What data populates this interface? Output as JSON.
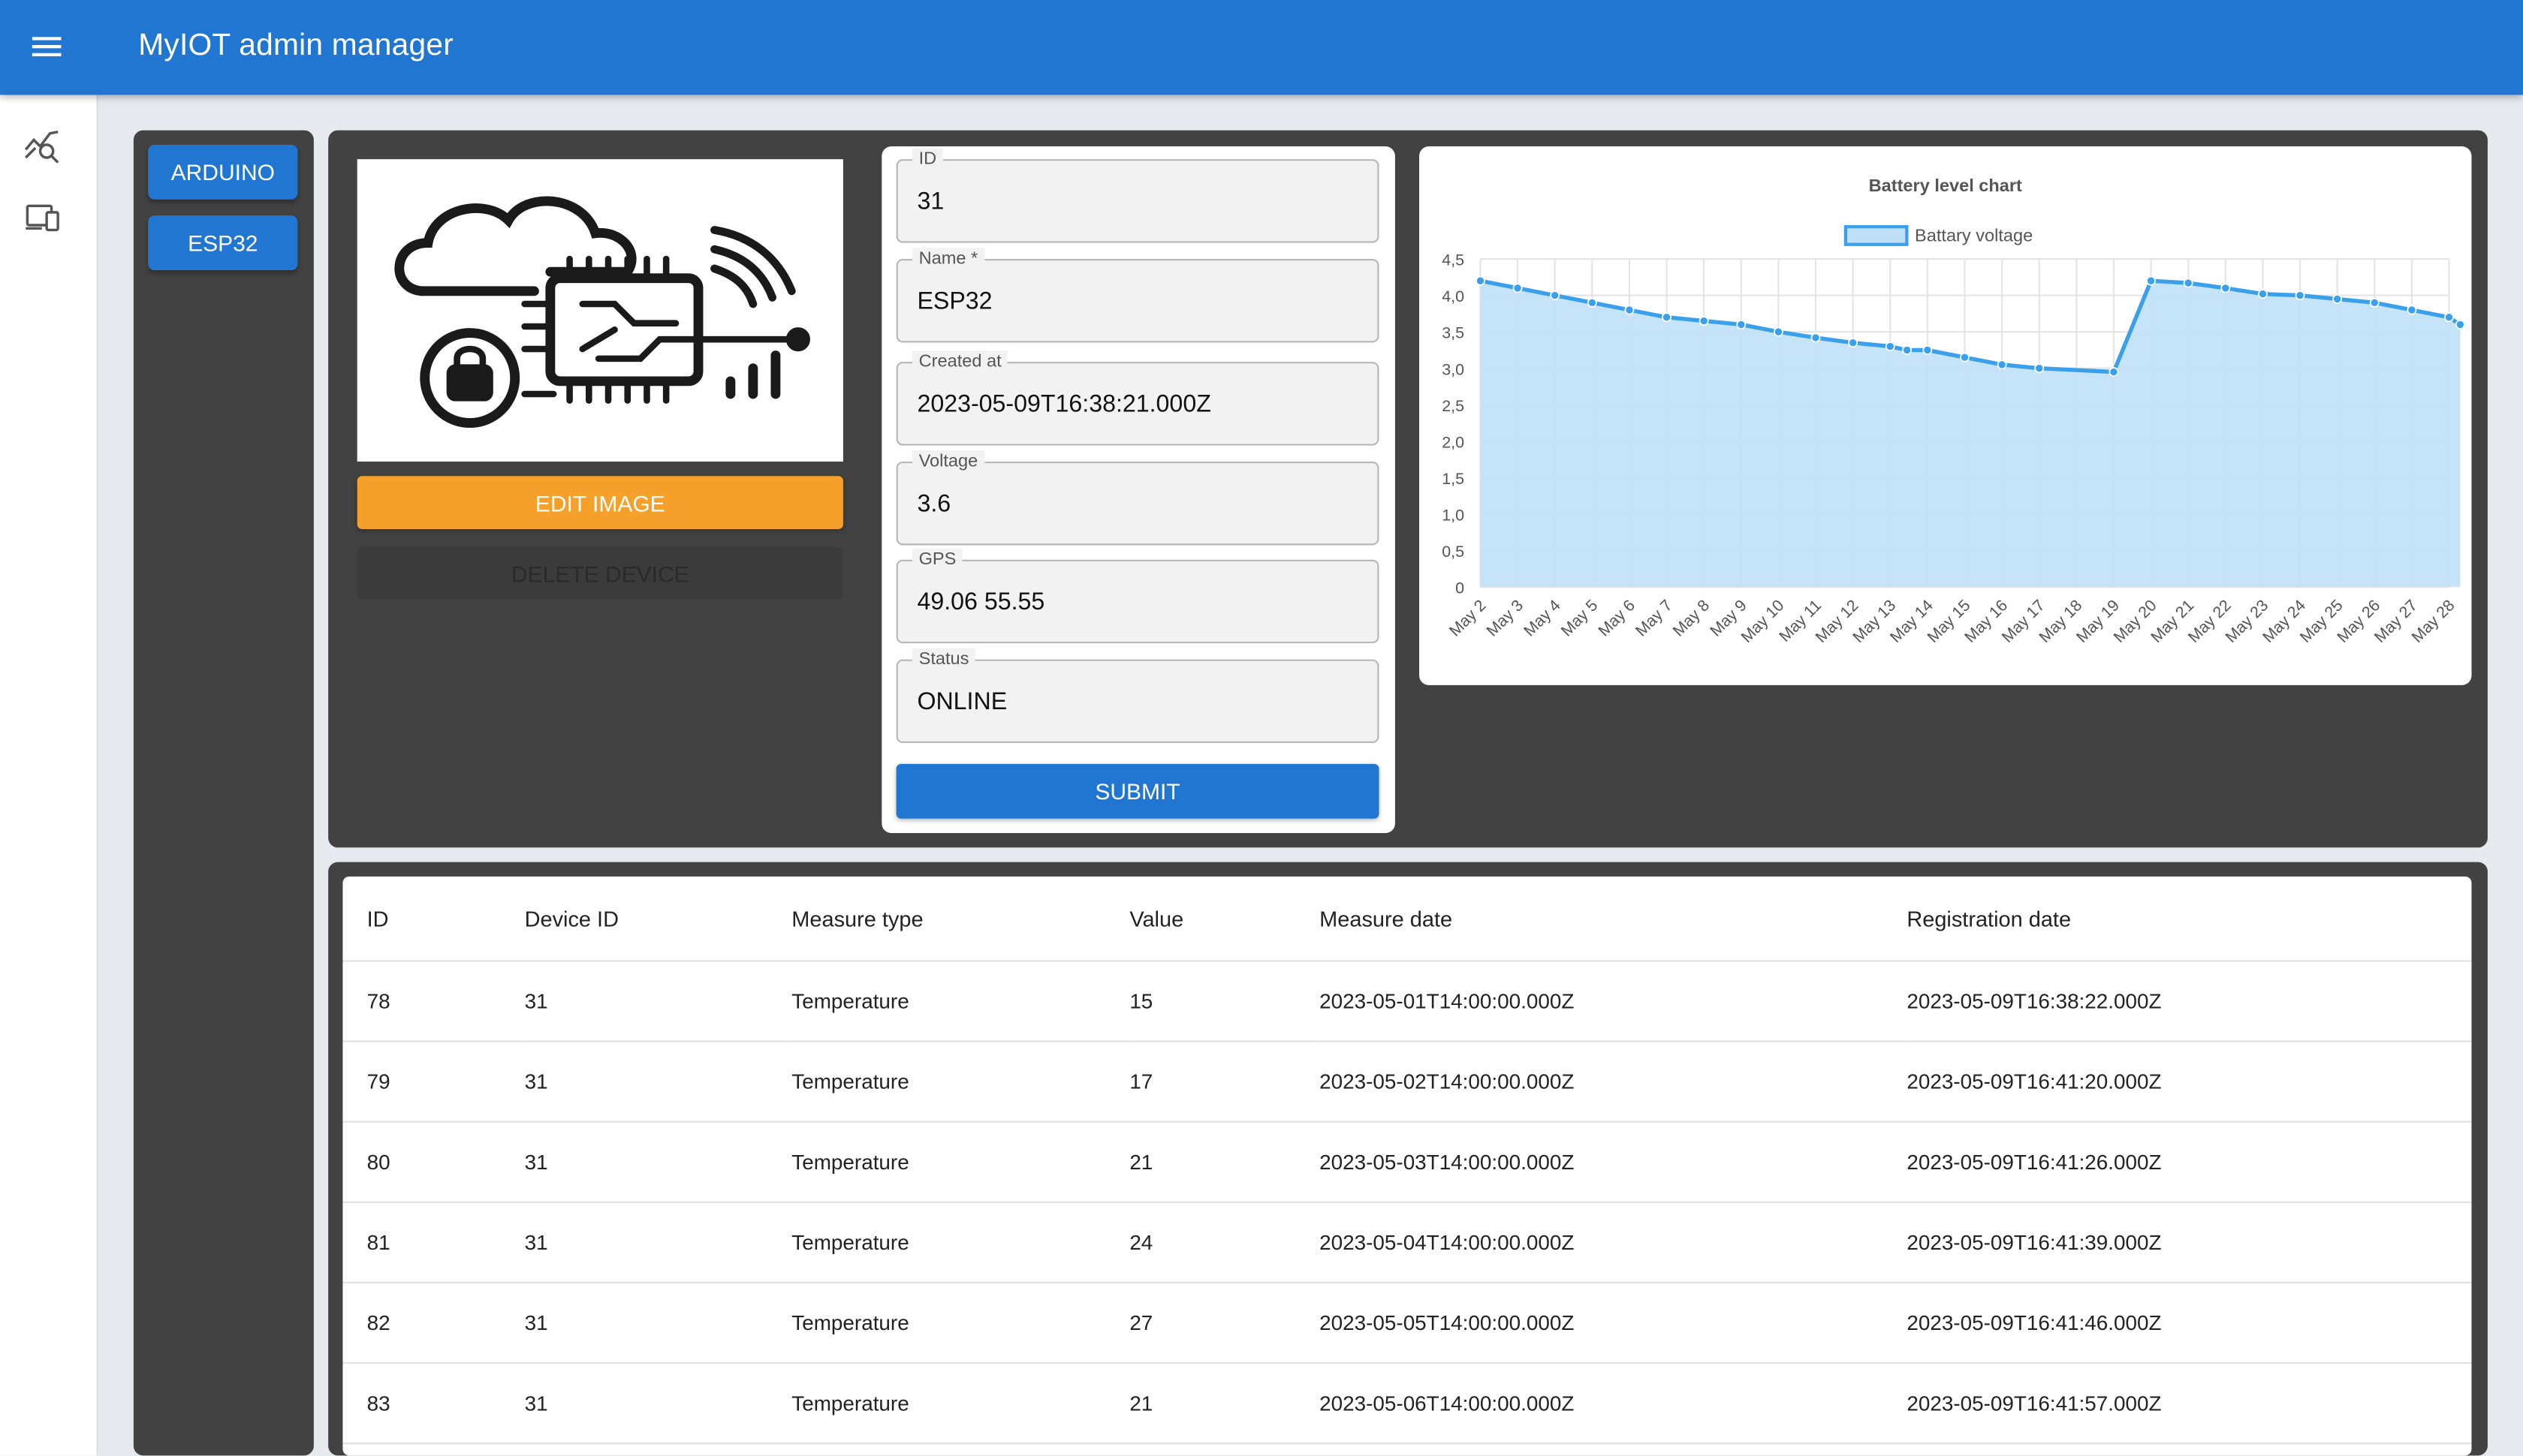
{
  "app": {
    "title": "MyIOT admin manager"
  },
  "nav": {
    "menu_icon": "hamburger-menu-icon",
    "items": [
      {
        "icon": "analytics-search-icon"
      },
      {
        "icon": "devices-icon"
      }
    ]
  },
  "devices": {
    "items": [
      {
        "label": "ARDUINO"
      },
      {
        "label": "ESP32"
      }
    ]
  },
  "device_actions": {
    "edit_label": "EDIT IMAGE",
    "delete_label": "DELETE DEVICE",
    "image": "iot-cloud-chip-illustration"
  },
  "form": {
    "fields": [
      {
        "label": "ID",
        "value": "31"
      },
      {
        "label": "Name *",
        "value": "ESP32"
      },
      {
        "label": "Created at",
        "value": "2023-05-09T16:38:21.000Z"
      },
      {
        "label": "Voltage",
        "value": "3.6"
      },
      {
        "label": "GPS",
        "value": "49.06 55.55"
      },
      {
        "label": "Status",
        "value": "ONLINE"
      }
    ],
    "submit_label": "SUBMIT"
  },
  "chart_data": {
    "type": "area",
    "title": "Battery level chart",
    "xlabel": "",
    "ylabel": "",
    "ylim": [
      0,
      4.5
    ],
    "yticks": [
      "0",
      "0,5",
      "1,0",
      "1,5",
      "2,0",
      "2,5",
      "3,0",
      "3,5",
      "4,0",
      "4,5"
    ],
    "grid": true,
    "legend": "top",
    "categories": [
      "May 2",
      "May 3",
      "May 4",
      "May 5",
      "May 6",
      "May 7",
      "May 8",
      "May 9",
      "May 10",
      "May 11",
      "May 12",
      "May 13",
      "May 14",
      "May 15",
      "May 16",
      "May 17",
      "May 18",
      "May 19",
      "May 20",
      "May 21",
      "May 22",
      "May 23",
      "May 24",
      "May 25",
      "May 26",
      "May 27",
      "May 28"
    ],
    "series": [
      {
        "name": "Battary voltage",
        "color": "#3aa0ec",
        "fill": "#bfe0f8",
        "points": [
          {
            "x": "May 2",
            "y": 4.2
          },
          {
            "x": "May 3",
            "y": 4.1
          },
          {
            "x": "May 4",
            "y": 4.0
          },
          {
            "x": "May 5",
            "y": 3.9
          },
          {
            "x": "May 6",
            "y": 3.8
          },
          {
            "x": "May 7",
            "y": 3.7
          },
          {
            "x": "May 8",
            "y": 3.65
          },
          {
            "x": "May 9",
            "y": 3.6
          },
          {
            "x": "May 10",
            "y": 3.5
          },
          {
            "x": "May 11",
            "y": 3.42
          },
          {
            "x": "May 12",
            "y": 3.35
          },
          {
            "x": "May 13",
            "y": 3.3
          },
          {
            "x": "May 13",
            "y": 3.25
          },
          {
            "x": "May 14",
            "y": 3.25
          },
          {
            "x": "May 15",
            "y": 3.15
          },
          {
            "x": "May 16",
            "y": 3.05
          },
          {
            "x": "May 17",
            "y": 3.0
          },
          {
            "x": "May 19",
            "y": 2.95
          },
          {
            "x": "May 20",
            "y": 4.2
          },
          {
            "x": "May 21",
            "y": 4.17
          },
          {
            "x": "May 22",
            "y": 4.1
          },
          {
            "x": "May 23",
            "y": 4.02
          },
          {
            "x": "May 24",
            "y": 4.0
          },
          {
            "x": "May 25",
            "y": 3.95
          },
          {
            "x": "May 26",
            "y": 3.9
          },
          {
            "x": "May 27",
            "y": 3.8
          },
          {
            "x": "May 28",
            "y": 3.7
          },
          {
            "x": "May 28",
            "y": 3.6
          }
        ]
      }
    ]
  },
  "table": {
    "columns": [
      "ID",
      "Device ID",
      "Measure type",
      "Value",
      "Measure date",
      "Registration date"
    ],
    "rows": [
      [
        "78",
        "31",
        "Temperature",
        "15",
        "2023-05-01T14:00:00.000Z",
        "2023-05-09T16:38:22.000Z"
      ],
      [
        "79",
        "31",
        "Temperature",
        "17",
        "2023-05-02T14:00:00.000Z",
        "2023-05-09T16:41:20.000Z"
      ],
      [
        "80",
        "31",
        "Temperature",
        "21",
        "2023-05-03T14:00:00.000Z",
        "2023-05-09T16:41:26.000Z"
      ],
      [
        "81",
        "31",
        "Temperature",
        "24",
        "2023-05-04T14:00:00.000Z",
        "2023-05-09T16:41:39.000Z"
      ],
      [
        "82",
        "31",
        "Temperature",
        "27",
        "2023-05-05T14:00:00.000Z",
        "2023-05-09T16:41:46.000Z"
      ],
      [
        "83",
        "31",
        "Temperature",
        "21",
        "2023-05-06T14:00:00.000Z",
        "2023-05-09T16:41:57.000Z"
      ]
    ]
  }
}
